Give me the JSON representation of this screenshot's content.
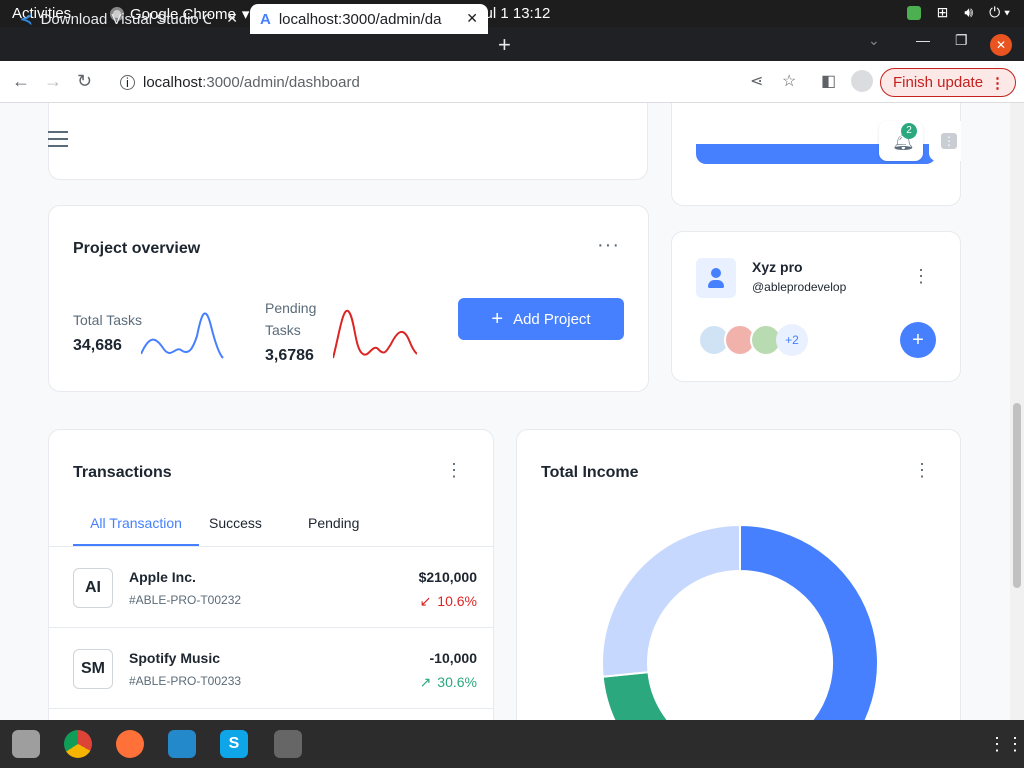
{
  "system": {
    "activities": "Activities",
    "app_name": "Google Chrome",
    "clock": "Jul 1  13:12"
  },
  "browser": {
    "tabs": [
      {
        "title": "Download Visual Studio C"
      },
      {
        "title": "localhost:3000/admin/da"
      }
    ],
    "url_host": "localhost",
    "url_path": ":3000/admin/dashboard",
    "finish_update": "Finish update"
  },
  "header": {
    "notification_count": "2"
  },
  "project_overview": {
    "title": "Project overview",
    "total_tasks_label": "Total Tasks",
    "total_tasks_value": "34,686",
    "pending_label_1": "Pending",
    "pending_label_2": "Tasks",
    "pending_value": "3,6786",
    "add_button": "Add Project"
  },
  "profile_card": {
    "name": "Xyz pro",
    "handle": "@ableprodevelop",
    "extra_count": "+2"
  },
  "transactions": {
    "title": "Transactions",
    "tabs": [
      "All Transaction",
      "Success",
      "Pending"
    ],
    "rows": [
      {
        "initials": "AI",
        "name": "Apple Inc.",
        "id": "#ABLE-PRO-T00232",
        "amount": "$210,000",
        "change": "10.6%",
        "direction": "down"
      },
      {
        "initials": "SM",
        "name": "Spotify Music",
        "id": "#ABLE-PRO-T00233",
        "amount": "-10,000",
        "change": "30.6%",
        "direction": "up"
      }
    ]
  },
  "total_income": {
    "title": "Total Income"
  },
  "colors": {
    "primary": "#4680ff",
    "danger": "#dc2626",
    "success": "#2ca87f",
    "warning": "#e58a00",
    "light_blue": "#c7d8ff"
  },
  "chart_data": {
    "type": "pie",
    "title": "Total Income",
    "series": [
      {
        "values": [
          31,
          4,
          23,
          21
        ]
      }
    ],
    "colors": [
      "#4680ff",
      "#e58a00",
      "#2ca87f",
      "#c7d8ff"
    ],
    "note_visible": "donut, partially cropped at bottom"
  }
}
